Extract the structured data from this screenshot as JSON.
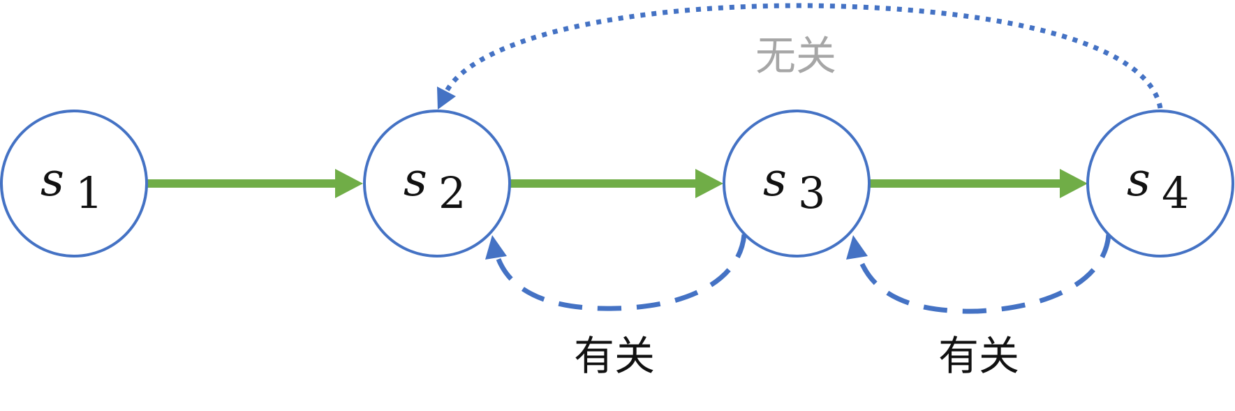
{
  "nodes": [
    {
      "id": "s1",
      "symbol": "s",
      "subscript": "1"
    },
    {
      "id": "s2",
      "symbol": "s",
      "subscript": "2"
    },
    {
      "id": "s3",
      "symbol": "s",
      "subscript": "3"
    },
    {
      "id": "s4",
      "symbol": "s",
      "subscript": "4"
    }
  ],
  "edges": {
    "forward": [
      {
        "from": "s1",
        "to": "s2",
        "style": "solid"
      },
      {
        "from": "s2",
        "to": "s3",
        "style": "solid"
      },
      {
        "from": "s3",
        "to": "s4",
        "style": "solid"
      }
    ],
    "back_related": [
      {
        "from": "s3",
        "to": "s2",
        "style": "dashed",
        "label": "有关"
      },
      {
        "from": "s4",
        "to": "s3",
        "style": "dashed",
        "label": "有关"
      }
    ],
    "back_unrelated": {
      "from": "s4",
      "to": "s2",
      "style": "dotted",
      "label": "无关"
    }
  },
  "colors": {
    "node_stroke": "#4472c4",
    "forward_edge": "#70ad47",
    "back_edge": "#4472c4",
    "related_label": "#111111",
    "unrelated_label": "#a6a6a6"
  }
}
